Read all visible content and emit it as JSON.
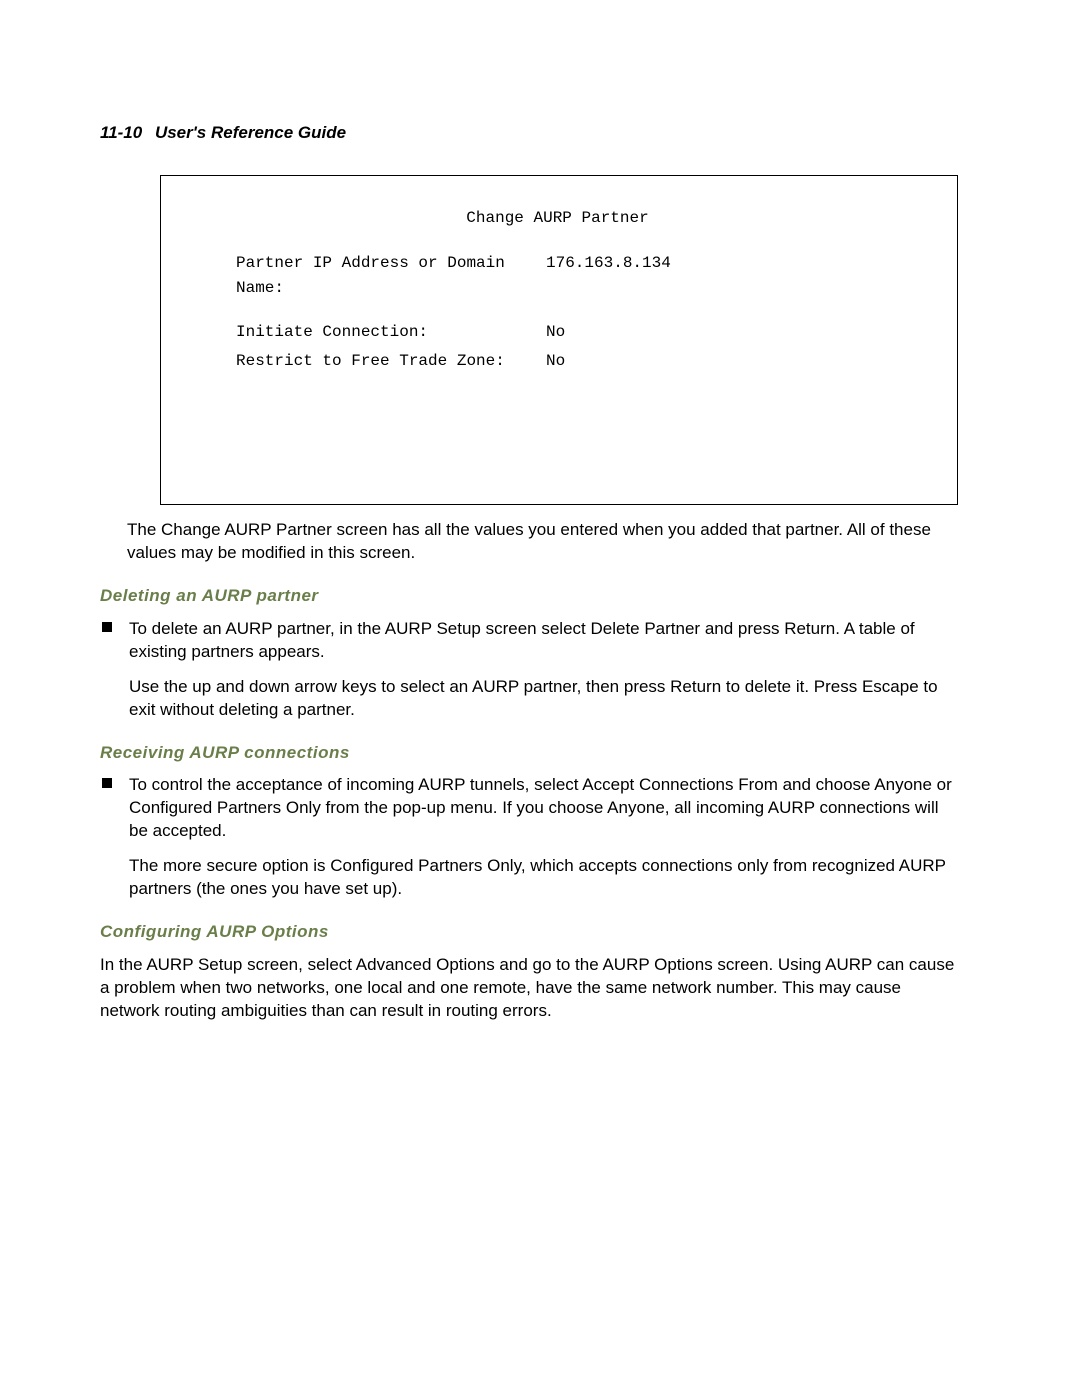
{
  "header": {
    "page_number": "11-10",
    "title": "User's Reference Guide"
  },
  "terminal": {
    "title": "Change AURP Partner",
    "rows": [
      {
        "label": "Partner IP Address or Domain Name:",
        "value": "176.163.8.134"
      },
      {
        "label": "Initiate Connection:",
        "value": "No"
      },
      {
        "label": "Restrict to Free Trade Zone:",
        "value": "No"
      }
    ]
  },
  "para_after_box": "The Change AURP Partner screen has all the values you entered when you added that partner. All of these values may be modified in this screen.",
  "section_delete": {
    "heading": "Deleting an AURP partner",
    "bullet_main": "To delete an AURP partner, in the AURP Setup screen select Delete Partner and press Return. A table of existing partners appears.",
    "bullet_sub": "Use the up and down arrow keys to select an AURP partner, then press Return to delete it. Press Escape to exit without deleting a partner."
  },
  "section_receive": {
    "heading": "Receiving AURP connections",
    "bullet_main": "To control the acceptance of incoming AURP tunnels, select Accept Connections From and choose Anyone or Configured Partners Only from the pop-up menu. If you choose Anyone, all incoming AURP connections will be accepted.",
    "bullet_sub": "The more secure option is Configured Partners Only, which accepts connections only from recognized AURP partners (the ones you have set up)."
  },
  "section_config": {
    "heading": "Configuring AURP Options",
    "para": "In the AURP Setup screen, select Advanced Options and go to the AURP Options screen. Using AURP can cause a problem when two networks, one local and one remote, have the same network number. This may cause network routing ambiguities than can result in routing errors."
  }
}
